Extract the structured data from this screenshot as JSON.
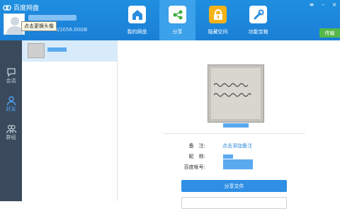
{
  "app": {
    "title": "百度网盘"
  },
  "user": {
    "avatar_tooltip": "点击更换头像",
    "storage_text": "815.53GB/2056.00GB"
  },
  "nav": {
    "items": [
      {
        "label": "我的网盘",
        "icon": "home-folder-icon"
      },
      {
        "label": "分享",
        "icon": "share-cloud-icon"
      },
      {
        "label": "隐藏空间",
        "icon": "lock-icon"
      },
      {
        "label": "功能宝箱",
        "icon": "toolbox-icon"
      }
    ],
    "active": "分享",
    "transfer_label": "传输"
  },
  "sidebar": {
    "items": [
      {
        "label": "会话",
        "icon": "chat-bubble-icon"
      },
      {
        "label": "好友",
        "icon": "person-icon"
      },
      {
        "label": "群组",
        "icon": "group-icon"
      }
    ],
    "active": "好友"
  },
  "detail": {
    "remark_label": "备　注:",
    "remark_link": "点击添加备注",
    "nickname_label": "昵　称:",
    "account_label": "百度帐号:",
    "share_button": "分享文件",
    "secondary_button": ""
  },
  "colors": {
    "header": "#1a7fd6",
    "accent": "#2f8fe4",
    "sidebar": "#3a4a5c",
    "transfer": "#55b84a"
  }
}
